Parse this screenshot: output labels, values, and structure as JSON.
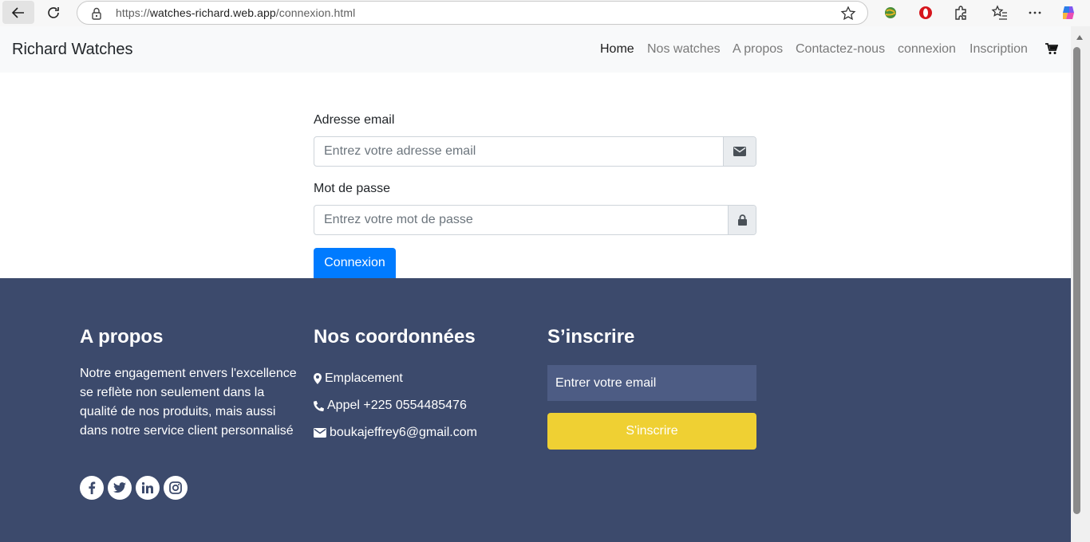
{
  "browser": {
    "url_scheme": "https://",
    "url_host": "watches-richard.web.app",
    "url_path": "/connexion.html"
  },
  "navbar": {
    "brand": "Richard Watches",
    "items": [
      {
        "label": "Home",
        "active": true
      },
      {
        "label": "Nos watches",
        "active": false
      },
      {
        "label": "A propos",
        "active": false
      },
      {
        "label": "Contactez-nous",
        "active": false
      },
      {
        "label": "connexion",
        "active": false
      },
      {
        "label": "Inscription",
        "active": false
      }
    ],
    "cart_icon": "cart-icon"
  },
  "form": {
    "email_label": "Adresse email",
    "email_placeholder": "Entrez votre adresse email",
    "password_label": "Mot de passe",
    "password_placeholder": "Entrez votre mot de passe",
    "submit_label": "Connexion"
  },
  "footer": {
    "about": {
      "title": "A propos",
      "text": "Notre engagement envers l'excellence se reflète non seulement dans la qualité de nos produits, mais aussi dans notre service client personnalisé",
      "socials": [
        "facebook-icon",
        "twitter-icon",
        "linkedin-icon",
        "instagram-icon"
      ]
    },
    "contact": {
      "title": "Nos coordonnées",
      "location": "Emplacement",
      "phone": "Appel +225 0554485476",
      "email": "boukajeffrey6@gmail.com"
    },
    "subscribe": {
      "title": "S’inscrire",
      "input_placeholder": "Entrer votre email",
      "button_label": "S'inscrire"
    }
  },
  "colors": {
    "primary": "#007bff",
    "footer_bg": "#3c4a6c",
    "subscribe_button": "#efd033",
    "navbar_bg": "#f8f9fa"
  }
}
